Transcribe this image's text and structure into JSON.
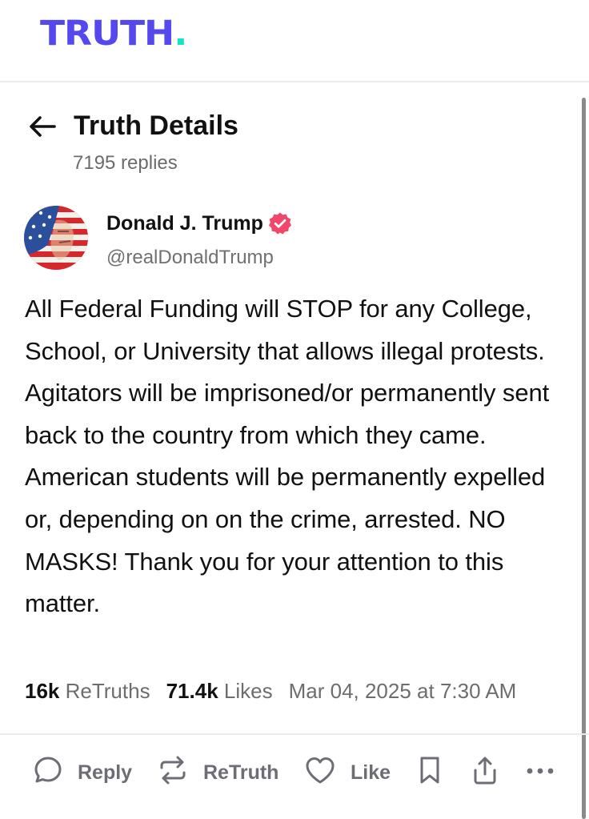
{
  "app": {
    "logo_text": "TRUTH",
    "logo_dot": ".",
    "brand_color": "#5448ee",
    "accent_color": "#17e3c4"
  },
  "header": {
    "title": "Truth Details",
    "replies": "7195 replies"
  },
  "post": {
    "author_name": "Donald J. Trump",
    "handle": "@realDonaldTrump",
    "verified_icon": "verified-badge-icon",
    "verified_color": "#f0476b",
    "text": "All Federal Funding will STOP for any College, School, or University that allows illegal protests. Agitators will be imprisoned/or permanently sent back to the country from which they came. American students will be permanently expelled or, depending on on the crime, arrested. NO MASKS! Thank you for your attention to this matter.",
    "retruths_count": "16k",
    "retruths_label": "ReTruths",
    "likes_count": "71.4k",
    "likes_label": "Likes",
    "timestamp": "Mar 04, 2025 at 7:30 AM"
  },
  "actions": {
    "reply_label": "Reply",
    "retruth_label": "ReTruth",
    "like_label": "Like"
  }
}
